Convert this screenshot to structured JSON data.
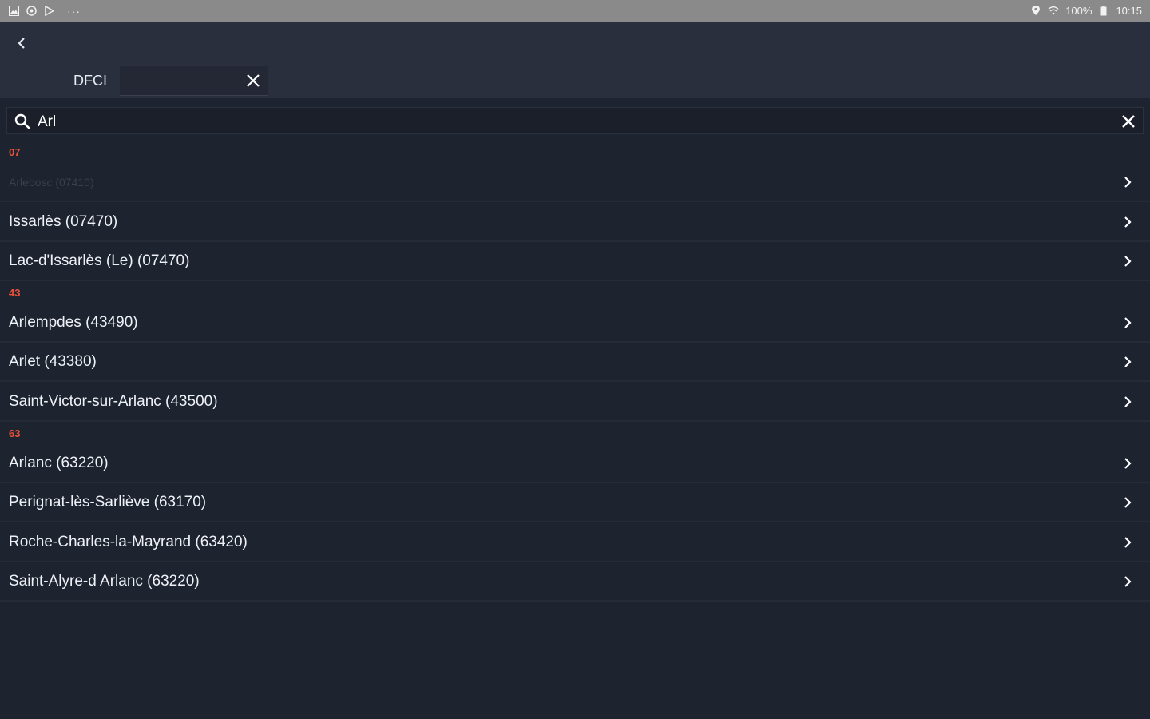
{
  "status_bar": {
    "icons_left": [
      "image-icon",
      "notification-icon",
      "play-store-icon"
    ],
    "more": "···",
    "battery": "100%",
    "time": "10:15"
  },
  "header": {
    "dfci_label": "DFCI",
    "dfci_value": ""
  },
  "search": {
    "value": "Arl"
  },
  "groups": [
    {
      "code": "07",
      "items": [
        {
          "label": "Arlebosc (07410)"
        },
        {
          "label": "Issarlès (07470)"
        },
        {
          "label": "Lac-d'Issarlès (Le) (07470)"
        }
      ]
    },
    {
      "code": "43",
      "items": [
        {
          "label": "Arlempdes (43490)"
        },
        {
          "label": "Arlet (43380)"
        },
        {
          "label": "Saint-Victor-sur-Arlanc (43500)"
        }
      ]
    },
    {
      "code": "63",
      "items": [
        {
          "label": "Arlanc (63220)"
        },
        {
          "label": "Perignat-lès-Sarliève (63170)"
        },
        {
          "label": "Roche-Charles-la-Mayrand (63420)"
        },
        {
          "label": "Saint-Alyre-d Arlanc (63220)"
        }
      ]
    }
  ],
  "colors": {
    "background": "#1e2330",
    "header": "#2a2f3d",
    "section_accent": "#e8523a",
    "status_bar": "#8a8a8a"
  }
}
